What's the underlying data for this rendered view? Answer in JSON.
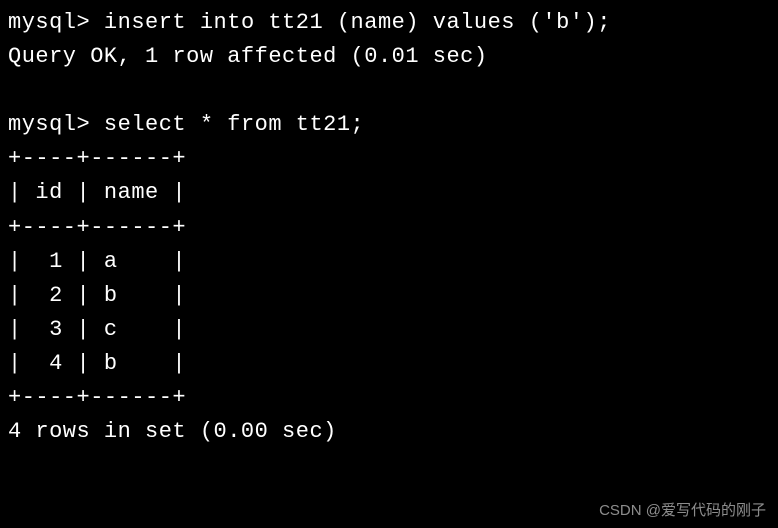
{
  "prompt": "mysql>",
  "cmd1": "insert into tt21 (name) values ('b');",
  "result1": "Query OK, 1 row affected (0.01 sec)",
  "cmd2": "select * from tt21;",
  "table": {
    "border_top": "+----+------+",
    "header": "| id | name |",
    "border_mid": "+----+------+",
    "rows": [
      "|  1 | a    |",
      "|  2 | b    |",
      "|  3 | c    |",
      "|  4 | b    |"
    ],
    "border_bot": "+----+------+"
  },
  "summary": "4 rows in set (0.00 sec)",
  "watermark": "CSDN @爱写代码的刚子"
}
